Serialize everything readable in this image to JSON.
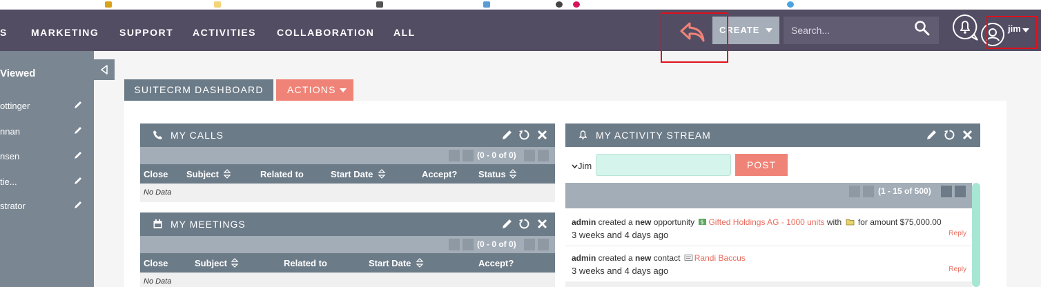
{
  "nav": {
    "items": [
      "S",
      "MARKETING",
      "SUPPORT",
      "ACTIVITIES",
      "COLLABORATION",
      "ALL"
    ],
    "create_label": "CREATE",
    "search_placeholder": "Search...",
    "user_name": "jim"
  },
  "sidebar": {
    "title": "Viewed",
    "items": [
      "ottinger",
      "nnan",
      "nsen",
      "tie...",
      "strator"
    ]
  },
  "tabs": {
    "dashboard": "SUITECRM DASHBOARD",
    "actions": "ACTIONS"
  },
  "calls": {
    "title": "MY CALLS",
    "pager": "(0 - 0 of 0)",
    "columns": [
      "Close",
      "Subject",
      "Related to",
      "Start Date",
      "Accept?",
      "Status"
    ],
    "no_data": "No Data"
  },
  "meetings": {
    "title": "MY MEETINGS",
    "pager": "(0 - 0 of 0)",
    "columns": [
      "Close",
      "Subject",
      "Related to",
      "Start Date",
      "Accept?"
    ],
    "no_data": "No Data"
  },
  "stream": {
    "title": "MY ACTIVITY STREAM",
    "user": "Jim",
    "post_label": "POST",
    "pager": "(1 - 15 of 500)",
    "entries": [
      {
        "actor": "admin",
        "text1": " created a ",
        "emph": "new",
        "text2": " opportunity ",
        "link": "Gifted Holdings AG - 1000 units",
        "text3": " with ",
        "text4": " for amount $75,000.00",
        "time": "3 weeks and 4 days ago",
        "reply": "Reply"
      },
      {
        "actor": "admin",
        "text1": " created a ",
        "emph": "new",
        "text2": " contact ",
        "link": "Randi Baccus",
        "time": "3 weeks and 4 days ago",
        "reply": "Reply"
      }
    ]
  },
  "colors": {
    "nav_bg": "#534d64",
    "accent": "#f08377",
    "header_bg": "#6c7b88",
    "highlight": "#e0101a"
  }
}
